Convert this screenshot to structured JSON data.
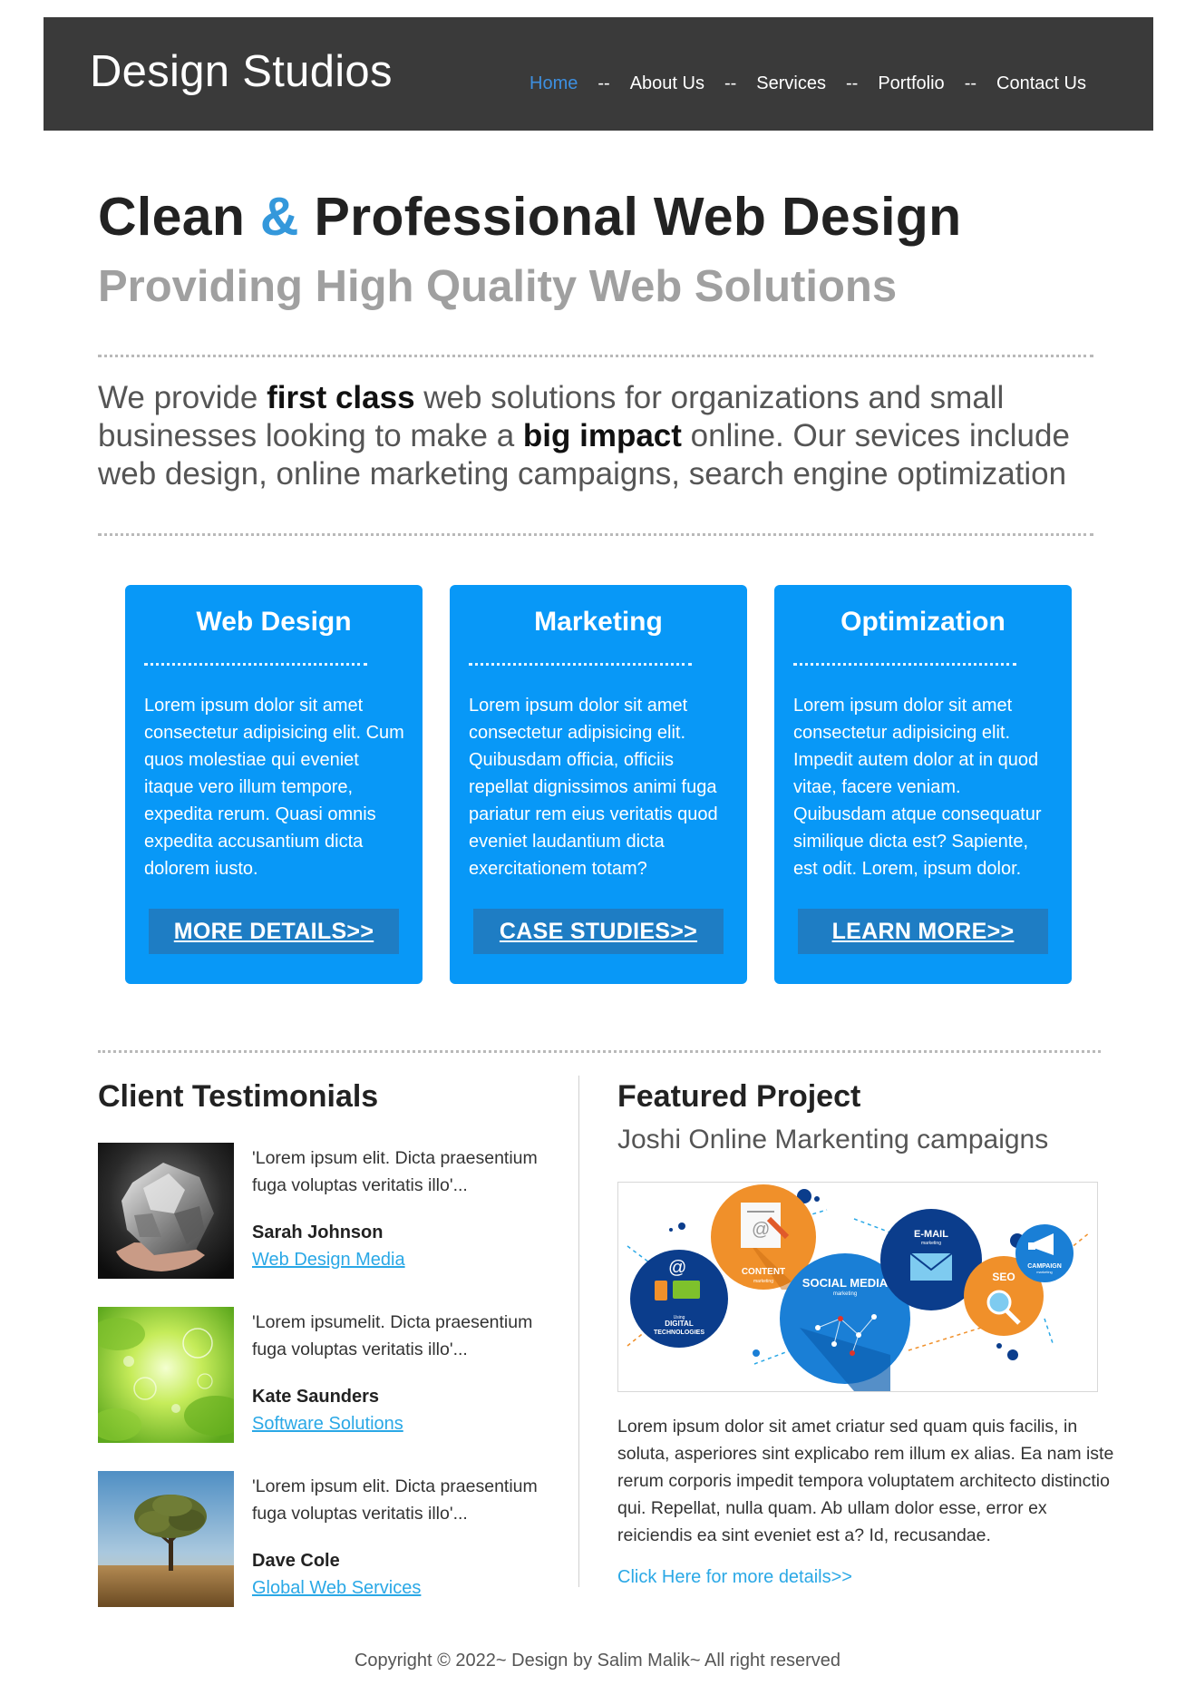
{
  "header": {
    "brand": "Design Studios",
    "nav": [
      {
        "label": "Home",
        "active": true
      },
      {
        "label": "About Us"
      },
      {
        "label": "Services"
      },
      {
        "label": "Portfolio"
      },
      {
        "label": "Contact Us"
      }
    ],
    "separator": "--",
    "active_color": "#3d8fe0",
    "background": "#3a3a3a"
  },
  "hero": {
    "title_part1": "Clean ",
    "title_amp": "&",
    "title_part2": " Professional Web Design",
    "subtitle": "Providing High Quality Web Solutions"
  },
  "intro": {
    "t1": "We provide ",
    "b1": "first class",
    "t2": " web solutions for organizations and small businesses looking to make a ",
    "b2": "big impact",
    "t3": " online. Our sevices include web design, online marketing campaigns, search engine optimization"
  },
  "cards": [
    {
      "title": "Web Design",
      "text": "Lorem ipsum dolor sit amet consectetur adipisicing elit. Cum quos molestiae qui eveniet itaque vero illum tempore, expedita rerum. Quasi omnis expedita accusantium dicta dolorem iusto.",
      "button": "MORE DETAILS>>"
    },
    {
      "title": "Marketing",
      "text": "Lorem ipsum dolor sit amet consectetur adipisicing elit. Quibusdam officia, officiis repellat dignissimos animi fuga pariatur rem eius veritatis quod eveniet laudantium dicta exercitationem totam?",
      "button": "CASE STUDIES>>"
    },
    {
      "title": "Optimization",
      "text": "Lorem ipsum dolor sit amet consectetur adipisicing elit. Impedit autem dolor at in quod vitae, facere veniam. Quibusdam atque consequatur similique dicta est? Sapiente, est odit. Lorem, ipsum dolor.",
      "button": "LEARN MORE>>"
    }
  ],
  "testimonials": {
    "heading": "Client Testimonials",
    "items": [
      {
        "quote": "'Lorem ipsum elit. Dicta praesentium fuga voluptas veritatis illo'...",
        "name": "Sarah Johnson",
        "org": "Web Design Media",
        "image": "rock-photo"
      },
      {
        "quote": "'Lorem ipsumelit. Dicta praesentium fuga voluptas veritatis illo'...",
        "name": "Kate Saunders",
        "org": "Software Solutions",
        "image": "green-bokeh-photo"
      },
      {
        "quote": "'Lorem ipsum elit. Dicta praesentium fuga voluptas veritatis illo'...",
        "name": "Dave Cole",
        "org": "Global Web Services",
        "image": "tree-photo"
      }
    ]
  },
  "project": {
    "heading": "Featured Project",
    "subtitle": "Joshi Online Markenting campaigns",
    "image_labels": {
      "content": "CONTENT",
      "content_sub": "marketing",
      "social": "SOCIAL MEDIA",
      "social_sub": "marketing",
      "email": "E-MAIL",
      "email_sub": "marketing",
      "seo": "SEO",
      "campaign": "CAMPAIGN",
      "campaign_sub": "marketing",
      "digital1": "Using",
      "digital2": "DIGITAL",
      "digital3": "TECHNOLOGIES"
    },
    "text": "Lorem ipsum dolor sit amet criatur sed quam quis facilis, in soluta, asperiores sint explicabo rem illum ex alias. Ea nam iste rerum corporis impedit tempora voluptatem architecto distinctio qui. Repellat, nulla quam. Ab ullam dolor esse, error ex reiciendis ea sint eveniet est a? Id, recusandae.",
    "link": "Click Here for more details>>"
  },
  "footer": {
    "text": "Copyright © 2022~ Design by Salim Malik~ All right reserved"
  },
  "colors": {
    "card_blue": "#0898f7",
    "button_blue": "#1e7dc4",
    "link_cyan": "#2aa8e6",
    "accent": "#3498db"
  }
}
